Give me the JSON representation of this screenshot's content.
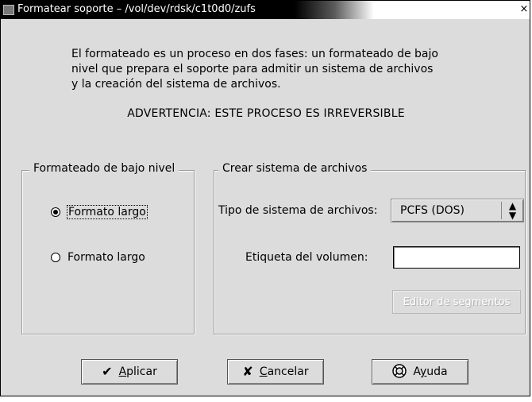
{
  "window": {
    "title": "Formatear soporte – /vol/dev/rdsk/c1t0d0/zufs",
    "close_glyph": "×"
  },
  "description": {
    "line1": "El formateado es un proceso en dos fases: un formateado de bajo",
    "line2": "nivel que prepara el soporte para admitir un sistema de archivos",
    "line3": "y la creación del sistema de archivos."
  },
  "warning": "ADVERTENCIA: ESTE PROCESO ES IRREVERSIBLE",
  "low_level": {
    "legend": "Formateado de bajo nivel",
    "options": [
      {
        "label": "Formato largo",
        "checked": true
      },
      {
        "label": "Formato largo",
        "checked": false
      }
    ]
  },
  "filesystem": {
    "legend": "Crear sistema de archivos",
    "type_label": "Tipo de sistema de archivos:",
    "type_value": "PCFS (DOS)",
    "volume_label": "Etiqueta del volumen:",
    "volume_value": "",
    "segment_editor_label": "Editor de segmentos",
    "segment_editor_enabled": false
  },
  "buttons": {
    "apply_first": "A",
    "apply_rest": "plicar",
    "cancel_first": "C",
    "cancel_rest": "ancelar",
    "help_pre": "A",
    "help_mn": "y",
    "help_rest": "uda"
  },
  "icons": {
    "apply": "check-icon",
    "cancel": "cross-icon",
    "help": "help-icon",
    "combo": "up-down-arrows-icon"
  }
}
